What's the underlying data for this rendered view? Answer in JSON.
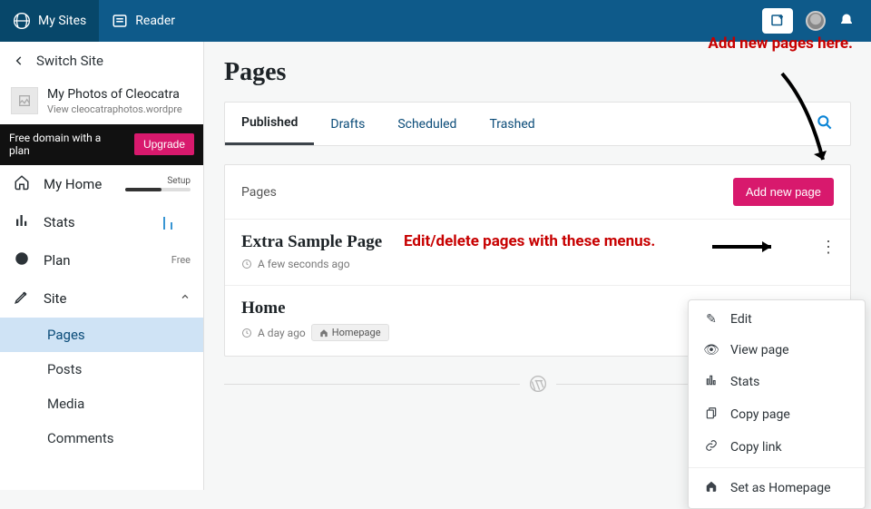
{
  "topbar": {
    "my_sites": "My Sites",
    "reader": "Reader"
  },
  "sidebar": {
    "switch": "Switch Site",
    "site_title": "My Photos of Cleocatra",
    "site_url": "View cleocatraphotos.wordpre",
    "promo_text": "Free domain with a plan",
    "upgrade": "Upgrade",
    "nav": {
      "home": "My Home",
      "setup": "Setup",
      "stats": "Stats",
      "plan": "Plan",
      "plan_tail": "Free",
      "site": "Site"
    },
    "sub": {
      "pages": "Pages",
      "posts": "Posts",
      "media": "Media",
      "comments": "Comments"
    }
  },
  "main": {
    "title": "Pages",
    "tabs": {
      "published": "Published",
      "drafts": "Drafts",
      "scheduled": "Scheduled",
      "trashed": "Trashed"
    },
    "list_label": "Pages",
    "add_btn": "Add new page",
    "rows": [
      {
        "title": "Extra Sample Page",
        "meta": "A few seconds ago",
        "homepage": false
      },
      {
        "title": "Home",
        "meta": "A day ago",
        "homepage": true,
        "homepage_label": "Homepage"
      }
    ]
  },
  "ctx": {
    "edit": "Edit",
    "view": "View page",
    "stats": "Stats",
    "copy_page": "Copy page",
    "copy_link": "Copy link",
    "set_hp": "Set as Homepage"
  },
  "annotations": {
    "add_here": "Add new pages here.",
    "edit_delete": "Edit/delete pages with these menus."
  }
}
